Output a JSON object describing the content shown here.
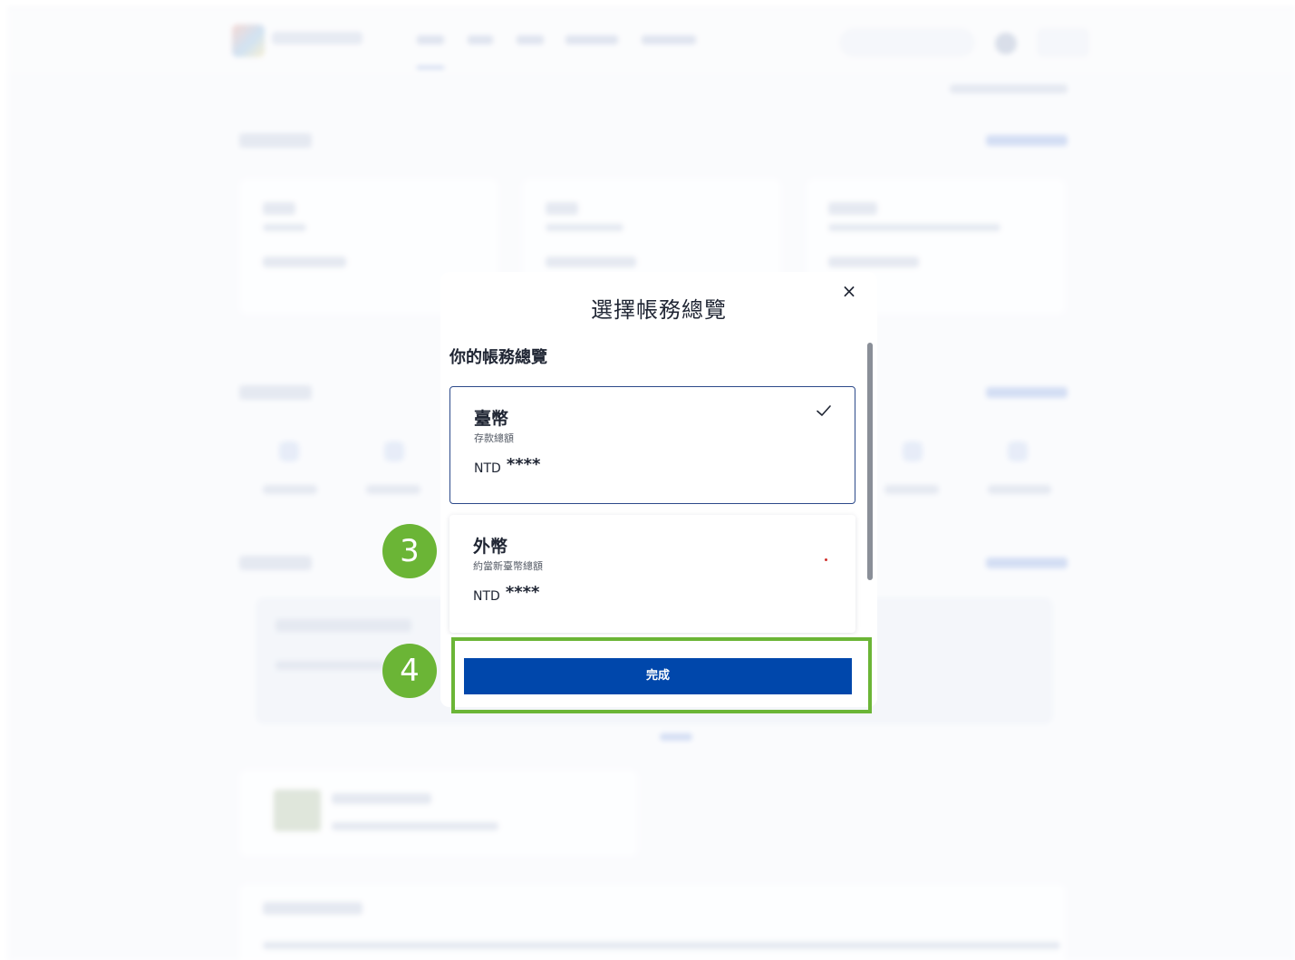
{
  "modal": {
    "title": "選擇帳務總覽",
    "close_label": "×",
    "section_label": "你的帳務總覽",
    "accounts": [
      {
        "name": "臺幣",
        "subtitle": "存款總額",
        "currency": "NTD",
        "amount": "****",
        "selected": true
      },
      {
        "name": "外幣",
        "subtitle": "約當新臺幣總額",
        "currency": "NTD",
        "amount": "****",
        "selected": false
      }
    ],
    "done_label": "完成"
  },
  "annotations": {
    "step3": "3",
    "step4": "4"
  },
  "colors": {
    "primary": "#0047ab",
    "annotation_green": "#6bb536",
    "selected_border": "#2d4a8a",
    "dot": "#d0312d"
  },
  "icons": [
    "close-icon",
    "check-icon",
    "dot-icon"
  ]
}
